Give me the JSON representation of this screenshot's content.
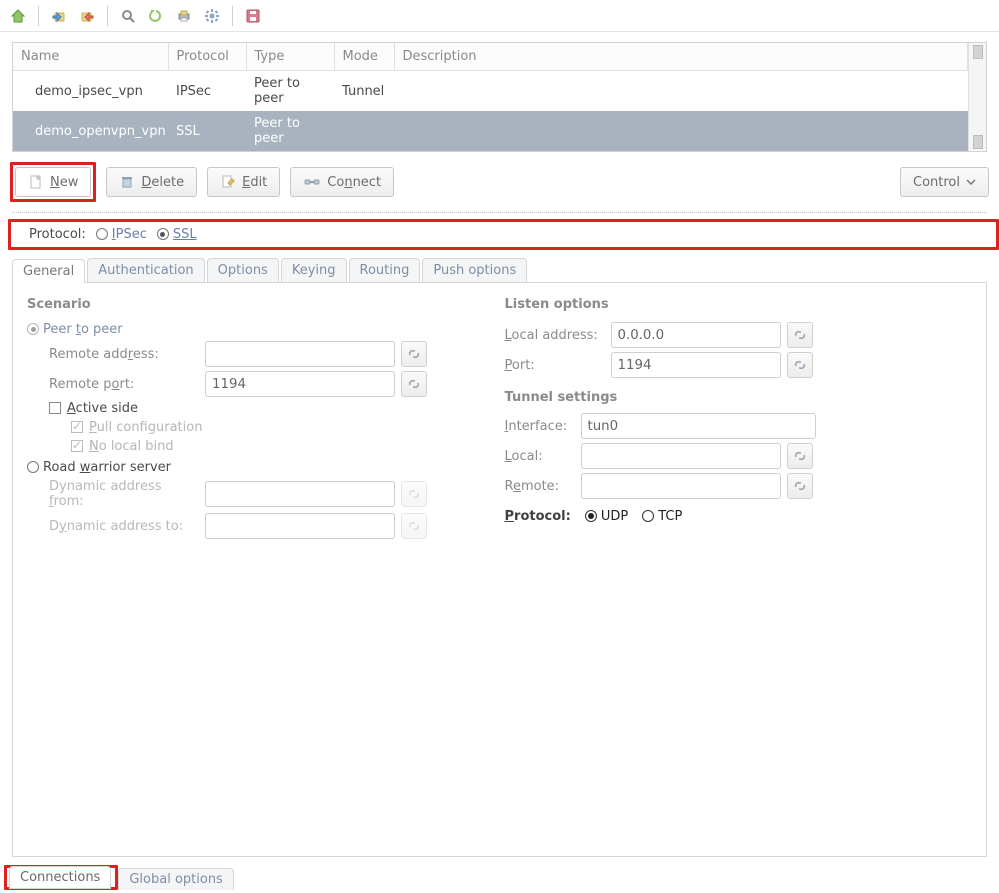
{
  "toolbarIcons": [
    "home",
    "import",
    "export",
    "search",
    "refresh",
    "print",
    "gear",
    "save"
  ],
  "table": {
    "headers": {
      "name": "Name",
      "protocol": "Protocol",
      "type": "Type",
      "mode": "Mode",
      "description": "Description"
    },
    "rows": [
      {
        "name": "demo_ipsec_vpn",
        "protocol": "IPSec",
        "type": "Peer to peer",
        "mode": "Tunnel",
        "description": ""
      },
      {
        "name": "demo_openvpn_vpn",
        "protocol": "SSL",
        "type": "Peer to peer",
        "mode": "",
        "description": ""
      }
    ],
    "selectedIndex": 1
  },
  "buttons": {
    "new": "New",
    "delete": "Delete",
    "edit": "Edit",
    "connect": "Connect",
    "control": "Control"
  },
  "protoSel": {
    "label": "Protocol:",
    "ipsec": "IPSec",
    "ssl": "SSL",
    "selected": "ssl"
  },
  "formTabs": {
    "general": "General",
    "auth": "Authentication",
    "options": "Options",
    "keying": "Keying",
    "routing": "Routing",
    "push": "Push options",
    "active": "general"
  },
  "left": {
    "scenario": "Scenario",
    "peerToPeer": "Peer to peer",
    "remoteAddrLabel": "Remote address:",
    "remoteAddr": "",
    "remotePortLabel": "Remote port:",
    "remotePort": "1194",
    "activeSide": "Active side",
    "pullCfg": "Pull configuration",
    "noLocalBind": "No local bind",
    "roadWarrior": "Road warrior server",
    "dynFromLabel": "Dynamic address from:",
    "dynFrom": "",
    "dynToLabel": "Dynamic address to:",
    "dynTo": ""
  },
  "right": {
    "listen": "Listen options",
    "localAddrLabel": "Local address:",
    "localAddr": "0.0.0.0",
    "portLabel": "Port:",
    "port": "1194",
    "tunnel": "Tunnel settings",
    "ifaceLabel": "Interface:",
    "iface": "tun0",
    "localLabel": "Local:",
    "localVal": "",
    "remoteLabel": "Remote:",
    "remoteVal": "",
    "protoLabel": "Protocol:",
    "udp": "UDP",
    "tcp": "TCP",
    "protoSel": "udp"
  },
  "bottomTabs": {
    "connections": "Connections",
    "global": "Global options",
    "active": "connections"
  }
}
